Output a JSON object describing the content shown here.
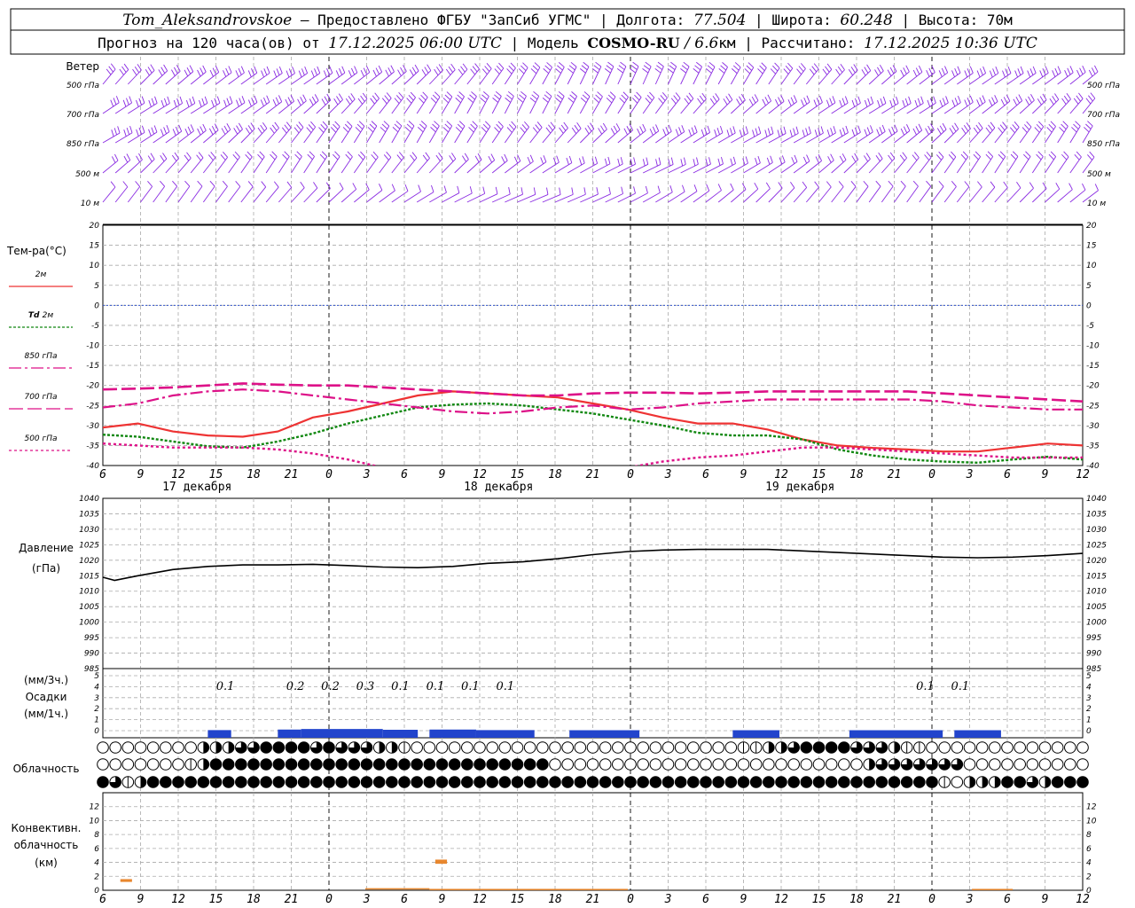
{
  "header": {
    "station": "Tom_Aleksandrovskoe",
    "line1_mid": " — Предоставлено ФГБУ \"ЗапСиб УГМС\" | Долгота: ",
    "longitude": "77.504",
    "lat_label": " | Широта: ",
    "latitude": "60.248",
    "alt_label": " | Высота: 70м",
    "forecast_label": "Прогноз на 120 часа(ов) от ",
    "forecast_start": "17.12.2025 06:00 UTC",
    "model_label": "  | Модель ",
    "model": "COSMO-RU",
    "model_res": " / 6.6",
    "model_unit": "км",
    "calc_label": " | Рассчитано: ",
    "calc_time": "17.12.2025 10:36 UTC"
  },
  "panels": {
    "wind": {
      "title": "Ветер",
      "levels": [
        "500 гПа",
        "700 гПа",
        "850 гПа",
        "500 м",
        "10  м"
      ],
      "color": "#8a2be2"
    },
    "temperature": {
      "title": "Тем-ра(°C)",
      "legend": [
        {
          "label": "2м",
          "color": "#ee3333",
          "dash": ""
        },
        {
          "label_it": "Td",
          "label": "2м",
          "color": "#118811",
          "dash": "3 2"
        },
        {
          "label": "850 гПа",
          "color": "#dd1188",
          "dash": "14 4 3 4"
        },
        {
          "label": "700 гПа",
          "color": "#dd1188",
          "dash": "16 5"
        },
        {
          "label": "500 гПа",
          "color": "#dd1188",
          "dash": "3 3"
        }
      ]
    },
    "pressure": {
      "title": "Давление",
      "unit": "(гПа)"
    },
    "precipitation": {
      "unit_top": "(мм/3ч.)",
      "title": "Осадки",
      "unit_bottom": "(мм/1ч.)"
    },
    "clouds": {
      "title": "Облачность"
    },
    "convective": {
      "title1": "Конвективн.",
      "title2": "облачность",
      "unit": "(км)"
    }
  },
  "x_ticks": [
    "6",
    "9",
    "12",
    "15",
    "18",
    "21",
    "0",
    "3",
    "6",
    "9",
    "12",
    "15",
    "18",
    "21",
    "0",
    "3",
    "6",
    "9",
    "12",
    "15",
    "18",
    "21",
    "0",
    "3",
    "6",
    "9",
    "12"
  ],
  "day_labels": [
    "17 декабря",
    "18 декабря",
    "19 декабря"
  ],
  "chart_data": [
    {
      "type": "line",
      "title": "Тем-ра(°C)",
      "ylim": [
        -40,
        20
      ],
      "y_ticks": [
        20,
        15,
        10,
        5,
        0,
        -5,
        -10,
        -15,
        -20,
        -25,
        -30,
        -35,
        -40
      ],
      "x_hours": [
        0,
        3,
        6,
        9,
        12,
        15,
        18,
        21,
        24,
        27,
        30,
        33,
        36,
        39,
        42,
        45,
        48,
        51,
        54,
        57,
        60,
        63,
        66,
        69,
        72,
        75,
        78
      ],
      "series": [
        {
          "name": "2м",
          "values": [
            -30.5,
            -29.5,
            -31.5,
            -32.5,
            -32.8,
            -31.5,
            -28.0,
            -26.5,
            -24.5,
            -22.5,
            -21.5,
            -22.0,
            -22.5,
            -23.0,
            -24.5,
            -26.0,
            -28.0,
            -29.5,
            -29.5,
            -31.0,
            -33.5,
            -35.0,
            -35.6,
            -36.0,
            -36.5,
            -36.5,
            -35.5,
            -34.5,
            -35.0
          ],
          "x_hours": [
            0,
            3,
            6,
            9,
            12,
            15,
            18,
            21,
            24,
            27,
            30,
            33,
            36,
            39,
            42,
            45,
            48,
            51,
            54,
            57,
            60,
            63,
            66,
            69,
            72,
            75,
            78,
            81,
            84
          ]
        },
        {
          "name": "Td 2м",
          "values": [
            -32.3,
            -32.8,
            -34.0,
            -35.2,
            -35.5,
            -34.0,
            -32.0,
            -29.5,
            -27.5,
            -25.5,
            -24.8,
            -24.5,
            -25.0,
            -26.0,
            -27.0,
            -28.5,
            -30.0,
            -31.8,
            -32.5,
            -32.5,
            -33.5,
            -36.0,
            -37.5,
            -38.5,
            -39.0,
            -39.3,
            -38.5,
            -37.8,
            -38.5
          ],
          "x_hours": [
            0,
            3,
            6,
            9,
            12,
            15,
            18,
            21,
            24,
            27,
            30,
            33,
            36,
            39,
            42,
            45,
            48,
            51,
            54,
            57,
            60,
            63,
            66,
            69,
            72,
            75,
            78,
            81,
            84
          ]
        },
        {
          "name": "850 гПа",
          "values": [
            -25.5,
            -24.5,
            -22.5,
            -21.5,
            -21.0,
            -21.5,
            -22.5,
            -23.5,
            -24.5,
            -25.5,
            -26.5,
            -27.0,
            -26.5,
            -25.5,
            -25.0,
            -26.0,
            -25.5,
            -24.5,
            -24.0,
            -23.5,
            -23.5,
            -23.5,
            -23.5,
            -23.5,
            -24.0,
            -25.0,
            -25.5,
            -26.0,
            -26.0
          ],
          "x_hours": [
            0,
            3,
            6,
            9,
            12,
            15,
            18,
            21,
            24,
            27,
            30,
            33,
            36,
            39,
            42,
            45,
            48,
            51,
            54,
            57,
            60,
            63,
            66,
            69,
            72,
            75,
            78,
            81,
            84
          ]
        },
        {
          "name": "700 гПа",
          "values": [
            -21.0,
            -20.8,
            -20.5,
            -20.0,
            -19.5,
            -19.8,
            -20.0,
            -20.0,
            -20.5,
            -21.0,
            -21.5,
            -22.0,
            -22.5,
            -22.5,
            -22.0,
            -21.8,
            -21.8,
            -22.0,
            -21.8,
            -21.5,
            -21.5,
            -21.5,
            -21.5,
            -21.5,
            -22.0,
            -22.5,
            -23.0,
            -23.5,
            -24.0
          ],
          "x_hours": [
            0,
            3,
            6,
            9,
            12,
            15,
            18,
            21,
            24,
            27,
            30,
            33,
            36,
            39,
            42,
            45,
            48,
            51,
            54,
            57,
            60,
            63,
            66,
            69,
            72,
            75,
            78,
            81,
            84
          ]
        },
        {
          "name": "500 гПа",
          "values": [
            -34.5,
            -35.0,
            -35.5,
            -35.5,
            -35.5,
            -36.0,
            -37.0,
            -38.5,
            -40.5,
            -43.0,
            -46.0,
            -48.0,
            -48.0,
            -46.0,
            -43.0,
            -40.5,
            -39.0,
            -38.0,
            -37.5,
            -36.5,
            -35.5,
            -35.5,
            -36.0,
            -36.5,
            -37.0,
            -37.5,
            -38.0,
            -38.0,
            -38.0
          ],
          "x_hours": [
            0,
            3,
            6,
            9,
            12,
            15,
            18,
            21,
            24,
            27,
            30,
            33,
            36,
            39,
            42,
            45,
            48,
            51,
            54,
            57,
            60,
            63,
            66,
            69,
            72,
            75,
            78,
            81,
            84
          ]
        }
      ]
    },
    {
      "type": "line",
      "title": "Давление",
      "ylabel": "(гПа)",
      "ylim": [
        985,
        1040
      ],
      "y_ticks": [
        1040,
        1035,
        1030,
        1025,
        1020,
        1015,
        1010,
        1005,
        1000,
        995,
        990,
        985
      ],
      "x_hours": [
        0,
        1,
        3,
        6,
        9,
        12,
        15,
        18,
        21,
        24,
        27,
        30,
        33,
        36,
        39,
        42,
        45,
        48,
        51,
        54,
        57,
        60,
        63,
        66,
        69,
        72,
        75,
        78,
        81,
        84
      ],
      "series": [
        {
          "name": "pressure",
          "values": [
            1014.5,
            1013.5,
            1015.0,
            1017.0,
            1018.0,
            1018.5,
            1018.5,
            1018.7,
            1018.3,
            1017.8,
            1017.6,
            1018.0,
            1019.0,
            1019.5,
            1020.5,
            1021.8,
            1022.8,
            1023.3,
            1023.5,
            1023.5,
            1023.5,
            1023.0,
            1022.5,
            1022.0,
            1021.5,
            1021.0,
            1020.8,
            1021.0,
            1021.5,
            1022.2
          ]
        }
      ]
    },
    {
      "type": "bar",
      "title": "Осадки",
      "ylim": [
        0,
        5
      ],
      "y_ticks": [
        5,
        4,
        3,
        2,
        1,
        0
      ],
      "labels_3h": [
        {
          "hour": 10.5,
          "text": "0.1"
        },
        {
          "hour": 16.5,
          "text": "0.2"
        },
        {
          "hour": 19.5,
          "text": "0.2"
        },
        {
          "hour": 22.5,
          "text": "0.3"
        },
        {
          "hour": 25.5,
          "text": "0.1"
        },
        {
          "hour": 28.5,
          "text": "0.1"
        },
        {
          "hour": 31.5,
          "text": "0.1"
        },
        {
          "hour": 34.5,
          "text": "0.1"
        },
        {
          "hour": 70.5,
          "text": "0.1"
        },
        {
          "hour": 73.5,
          "text": "0.1"
        }
      ],
      "hourly_segments": [
        {
          "from": 9,
          "to": 11,
          "value": 0.05
        },
        {
          "from": 15,
          "to": 17,
          "value": 0.1
        },
        {
          "from": 17,
          "to": 24,
          "value": 0.15
        },
        {
          "from": 24,
          "to": 27,
          "value": 0.08
        },
        {
          "from": 28,
          "to": 32,
          "value": 0.1
        },
        {
          "from": 32,
          "to": 37,
          "value": 0.05
        },
        {
          "from": 40,
          "to": 46,
          "value": 0.04
        },
        {
          "from": 54,
          "to": 58,
          "value": 0.04
        },
        {
          "from": 64,
          "to": 72,
          "value": 0.04
        },
        {
          "from": 73,
          "to": 77,
          "value": 0.04
        }
      ]
    },
    {
      "type": "bar",
      "title": "Конвективн. облачность",
      "ylabel": "(км)",
      "ylim": [
        0,
        14
      ],
      "y_ticks": [
        12,
        10,
        8,
        6,
        4,
        2,
        0
      ],
      "bars": [
        {
          "from": 1.5,
          "to": 2.5,
          "base": 1.2,
          "top": 1.6
        },
        {
          "from": 28.5,
          "to": 29.5,
          "base": 3.8,
          "top": 4.4
        },
        {
          "from": 22.5,
          "to": 28.0,
          "base": 0.1,
          "top": 0.3
        },
        {
          "from": 28.0,
          "to": 45.0,
          "base": 0.05,
          "top": 0.2
        },
        {
          "from": 74.5,
          "to": 78.0,
          "base": 0.05,
          "top": 0.2
        }
      ]
    }
  ],
  "cloud_rows": {
    "high": "00000000000122222334444444344343322221000000000000000000000000000000000000000001112233444444333332211000000000000000000000",
    "mid": "00000000000132444444444444444444444444444444444444444444430000000000000000000000000000000000000000123333333333300000000000000000",
    "low": "4341244444444444444444444444444444444444444444444444444444444444444444444444444444444444444444444444444444444412012222344434243444"
  }
}
